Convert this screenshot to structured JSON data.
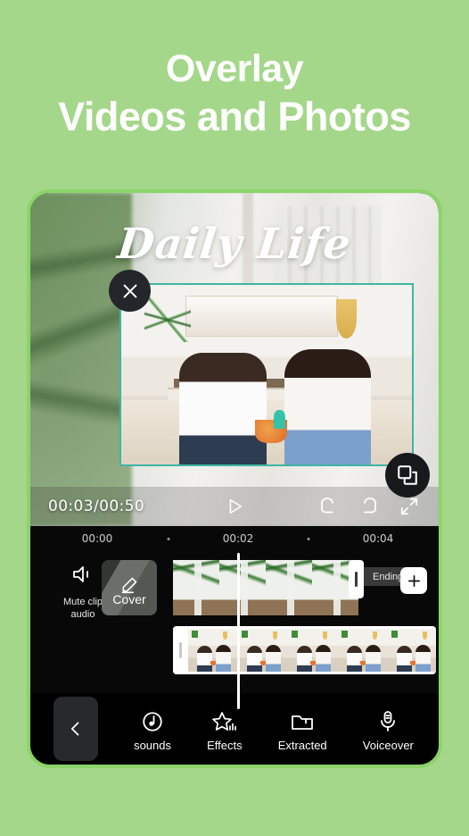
{
  "headline": {
    "line1": "Overlay",
    "line2": "Videos and Photos"
  },
  "colors": {
    "background": "#a4d78a",
    "frame_border": "#8bd46a",
    "overlay_selection": "#3fb5a4",
    "timeline_bg": "#080808"
  },
  "preview": {
    "title_text": "Daily Life",
    "close_icon": "close-icon",
    "resize_icon": "layers-icon",
    "player": {
      "time": "00:03/00:50",
      "play_icon": "play-icon",
      "undo_icon": "undo-icon",
      "redo_icon": "redo-icon",
      "fullscreen_icon": "fullscreen-icon"
    }
  },
  "timeline": {
    "ruler_labels": [
      "00:00",
      "00:02",
      "00:04"
    ],
    "mute": {
      "label_line1": "Mute clip",
      "label_line2": "audio",
      "icon": "speaker-mute-icon"
    },
    "cover": {
      "label": "Cover",
      "icon": "pencil-icon"
    },
    "ending_tag": "Ending",
    "add_button": "+",
    "main_clip_thumbs": 4,
    "overlay_clip_thumbs": 5
  },
  "bottom_nav": {
    "back_icon": "chevron-left-icon",
    "items": [
      {
        "label": "sounds",
        "icon": "music-note-icon"
      },
      {
        "label": "Effects",
        "icon": "star-effects-icon"
      },
      {
        "label": "Extracted",
        "icon": "folder-icon"
      },
      {
        "label": "Voiceover",
        "icon": "microphone-icon"
      }
    ]
  }
}
